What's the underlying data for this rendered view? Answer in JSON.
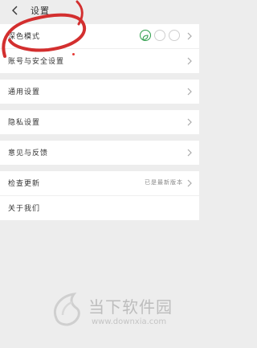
{
  "header": {
    "title": "设置"
  },
  "groups": [
    {
      "rows": [
        {
          "label": "深色模式"
        },
        {
          "label": "账号与安全设置",
          "badge": "new"
        }
      ]
    },
    {
      "rows": [
        {
          "label": "通用设置"
        }
      ]
    },
    {
      "rows": [
        {
          "label": "隐私设置"
        }
      ]
    },
    {
      "rows": [
        {
          "label": "意见与反馈"
        }
      ]
    },
    {
      "rows": [
        {
          "label": "检查更新",
          "value": "已是最新版本"
        },
        {
          "label": "关于我们"
        }
      ]
    }
  ],
  "watermark": {
    "text": "当下软件园",
    "url": "www.downxia.com"
  },
  "colors": {
    "accent_green": "#2e9e4b",
    "annotation_red": "#d32f2f",
    "badge_red": "#e53935"
  }
}
